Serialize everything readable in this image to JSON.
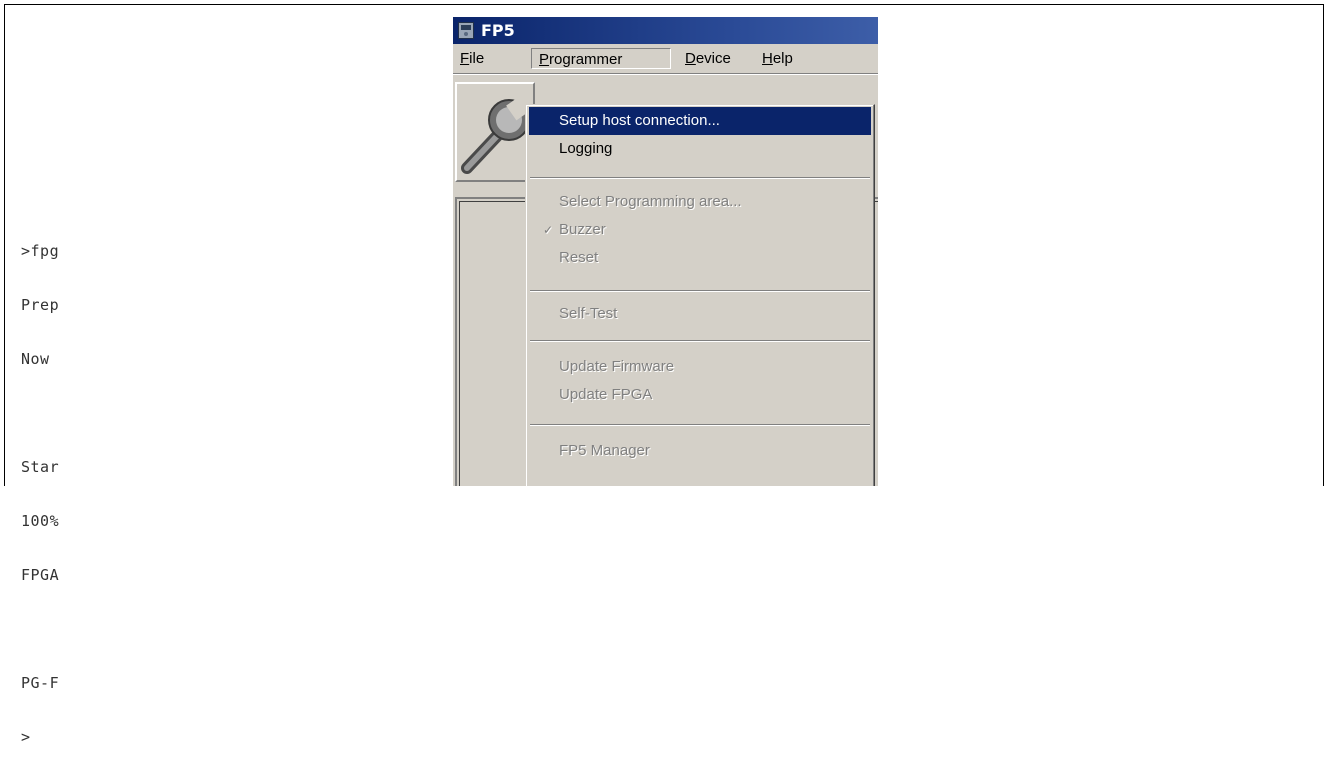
{
  "window": {
    "title": "FP5",
    "icon": "fp5-app-icon"
  },
  "menubar": {
    "items": [
      {
        "label": "File",
        "mnemonic": "F",
        "rest": "ile"
      },
      {
        "label": "Programmer",
        "mnemonic": "P",
        "rest": "rogrammer"
      },
      {
        "label": "Device",
        "mnemonic": "D",
        "rest": "evice"
      },
      {
        "label": "Help",
        "mnemonic": "H",
        "rest": "elp"
      }
    ]
  },
  "toolbar": {
    "icon": "wrench-icon"
  },
  "console": {
    "lines": [
      ">fpg",
      "Prep",
      "Now",
      "",
      "Star",
      "100%",
      "FPGA",
      "",
      "PG-F",
      ">"
    ]
  },
  "programmer_menu": {
    "items": [
      {
        "label": "Setup host connection...",
        "state": "highlighted"
      },
      {
        "label": "Logging",
        "state": "enabled"
      },
      {
        "label": "Select Programming area...",
        "state": "disabled"
      },
      {
        "label": "Buzzer",
        "state": "disabled",
        "checked": true
      },
      {
        "label": "Reset",
        "state": "disabled"
      },
      {
        "label": "Self-Test",
        "state": "disabled"
      },
      {
        "label": "Update Firmware",
        "state": "disabled"
      },
      {
        "label": "Update FPGA",
        "state": "disabled"
      },
      {
        "label": "FP5 Manager",
        "state": "disabled"
      }
    ],
    "check_glyph": "✓"
  },
  "colors": {
    "titlebar": "#0a246a",
    "face": "#d4d0c8",
    "highlight": "#0a246a",
    "disabled_text": "#808080"
  }
}
